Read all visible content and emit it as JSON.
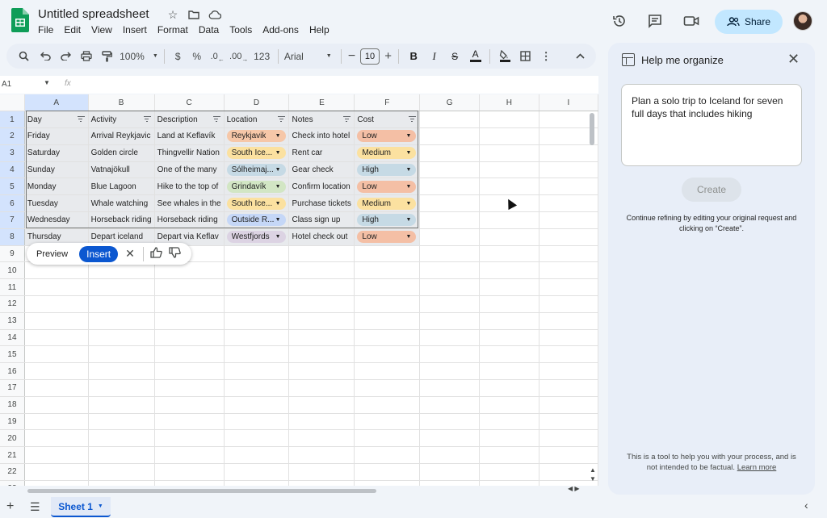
{
  "app": {
    "title": "Untitled spreadsheet",
    "menu": [
      "File",
      "Edit",
      "View",
      "Insert",
      "Format",
      "Data",
      "Tools",
      "Add-ons",
      "Help"
    ],
    "share_label": "Share",
    "icons": [
      "star-icon",
      "move-folder-icon",
      "cloud-status-icon",
      "history-icon",
      "comments-icon",
      "meet-icon",
      "avatar"
    ]
  },
  "toolbar": {
    "zoom": "100%",
    "currency": "$",
    "percent": "%",
    "decrease_decimal": ".0",
    "increase_decimal": ".00",
    "number_format": "123",
    "font": "Arial",
    "font_size": "10"
  },
  "formula_bar": {
    "cell_ref": "A1",
    "fx": "fx"
  },
  "grid": {
    "columns": [
      "A",
      "B",
      "C",
      "D",
      "E",
      "F",
      "G",
      "H",
      "I"
    ],
    "rows": [
      "1",
      "2",
      "3",
      "4",
      "5",
      "6",
      "7",
      "8",
      "9",
      "10",
      "11",
      "12",
      "13",
      "14",
      "15",
      "16",
      "17",
      "18",
      "19",
      "20",
      "21",
      "22",
      "23"
    ],
    "headers": [
      "Day",
      "Activity",
      "Description",
      "Location",
      "Notes",
      "Cost"
    ],
    "data": [
      {
        "day": "Friday",
        "activity": "Arrival Reykjavic",
        "description": "Land at Keflavík",
        "location": "Reykjavik",
        "notes": "Check into hotel",
        "cost": "Low"
      },
      {
        "day": "Saturday",
        "activity": "Golden circle",
        "description": "Thingvellir Nation",
        "location": "South Ice...",
        "notes": "Rent car",
        "cost": "Medium"
      },
      {
        "day": "Sunday",
        "activity": "Vatnajökull",
        "description": "One of the many",
        "location": "Sólheimaj...",
        "notes": "Gear check",
        "cost": "High"
      },
      {
        "day": "Monday",
        "activity": "Blue Lagoon",
        "description": "Hike to the top of",
        "location": "Grindavík",
        "notes": "Confirm location",
        "cost": "Low"
      },
      {
        "day": "Tuesday",
        "activity": "Whale watching",
        "description": "See whales in the",
        "location": "South Ice...",
        "notes": "Purchase tickets",
        "cost": "Medium"
      },
      {
        "day": "Wednesday",
        "activity": "Horseback riding",
        "description": "Horseback riding",
        "location": "Outside R...",
        "notes": "Class sign up",
        "cost": "High"
      },
      {
        "day": "Thursday",
        "activity": "Depart iceland",
        "description": "Depart via Keflav",
        "location": "Westfjords",
        "notes": "Hotel check out",
        "cost": "Low"
      }
    ],
    "chip_colors": {
      "Reykjavik": "#f6c7a8",
      "South Ice...": "#fbe1a0",
      "Sólheimaj...": "#c6dae5",
      "Grindavík": "#d2e6c4",
      "Outside R...": "#c5d7f7",
      "Westfjords": "#dcd3e3",
      "Low": "#f4bfa5",
      "Medium": "#fbe1a0",
      "High": "#c6dae5"
    }
  },
  "action_bar": {
    "preview": "Preview",
    "insert": "Insert"
  },
  "sheet_tab": "Sheet 1",
  "panel": {
    "title": "Help me organize",
    "prompt": "Plan a solo trip to Iceland for seven full days that includes hiking",
    "create_label": "Create",
    "hint": "Continue refining by editing your original request and clicking on “Create”.",
    "disclaimer": "This is a tool to help you with your process, and is not intended to be factual.",
    "learn_more": "Learn more"
  }
}
